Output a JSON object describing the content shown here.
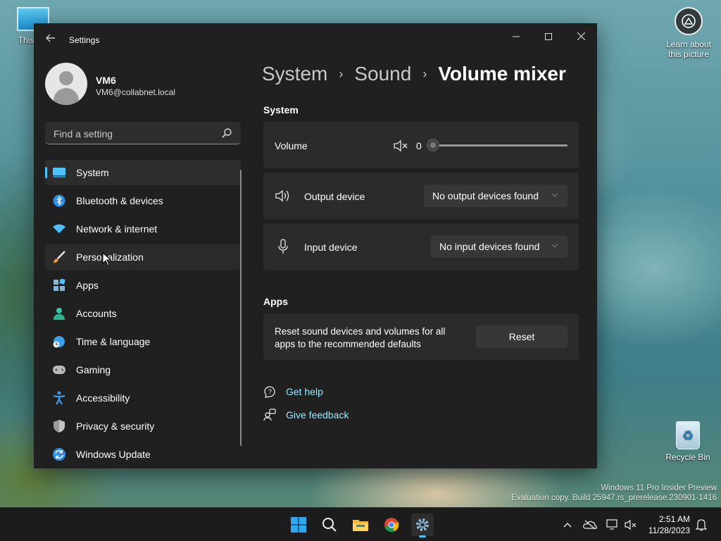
{
  "desktop": {
    "this_pc_label": "This PC",
    "learn_label": "Learn about this picture",
    "recycle_bin_label": "Recycle Bin",
    "watermark_line1": "Windows 11 Pro Insider Preview",
    "watermark_line2": "Evaluation copy. Build 25947.rs_prerelease.230901-1416"
  },
  "window": {
    "title": "Settings",
    "back_icon": "arrow-left-icon",
    "controls": [
      "minimize",
      "maximize",
      "close"
    ]
  },
  "profile": {
    "name": "VM6",
    "email": "VM6@collabnet.local"
  },
  "search": {
    "placeholder": "Find a setting"
  },
  "nav": {
    "items": [
      {
        "label": "System",
        "icon": "system-icon",
        "active": true
      },
      {
        "label": "Bluetooth & devices",
        "icon": "bluetooth-icon"
      },
      {
        "label": "Network & internet",
        "icon": "wifi-icon"
      },
      {
        "label": "Personalization",
        "icon": "brush-icon",
        "hover": true
      },
      {
        "label": "Apps",
        "icon": "apps-icon"
      },
      {
        "label": "Accounts",
        "icon": "accounts-icon"
      },
      {
        "label": "Time & language",
        "icon": "globe-clock-icon"
      },
      {
        "label": "Gaming",
        "icon": "gamepad-icon"
      },
      {
        "label": "Accessibility",
        "icon": "accessibility-icon"
      },
      {
        "label": "Privacy & security",
        "icon": "shield-icon"
      },
      {
        "label": "Windows Update",
        "icon": "update-icon"
      }
    ]
  },
  "breadcrumb": {
    "items": [
      "System",
      "Sound",
      "Volume mixer"
    ]
  },
  "system_section": {
    "title": "System",
    "volume": {
      "label": "Volume",
      "value": "0",
      "level": 0
    },
    "output": {
      "label": "Output device",
      "selected": "No output devices found"
    },
    "input": {
      "label": "Input device",
      "selected": "No input devices found"
    }
  },
  "apps_section": {
    "title": "Apps",
    "reset_line1": "Reset sound devices and volumes for all",
    "reset_line2": "apps to the recommended defaults",
    "reset_button": "Reset"
  },
  "links": {
    "help": "Get help",
    "feedback": "Give feedback"
  },
  "taskbar": {
    "apps": [
      "start",
      "search",
      "file-explorer",
      "chrome",
      "settings"
    ],
    "time": "2:51 AM",
    "date": "11/28/2023"
  },
  "colors": {
    "accent": "#4cc2ff",
    "link": "#99ebff",
    "window_bg": "#202020",
    "card_bg": "#2b2b2b"
  }
}
